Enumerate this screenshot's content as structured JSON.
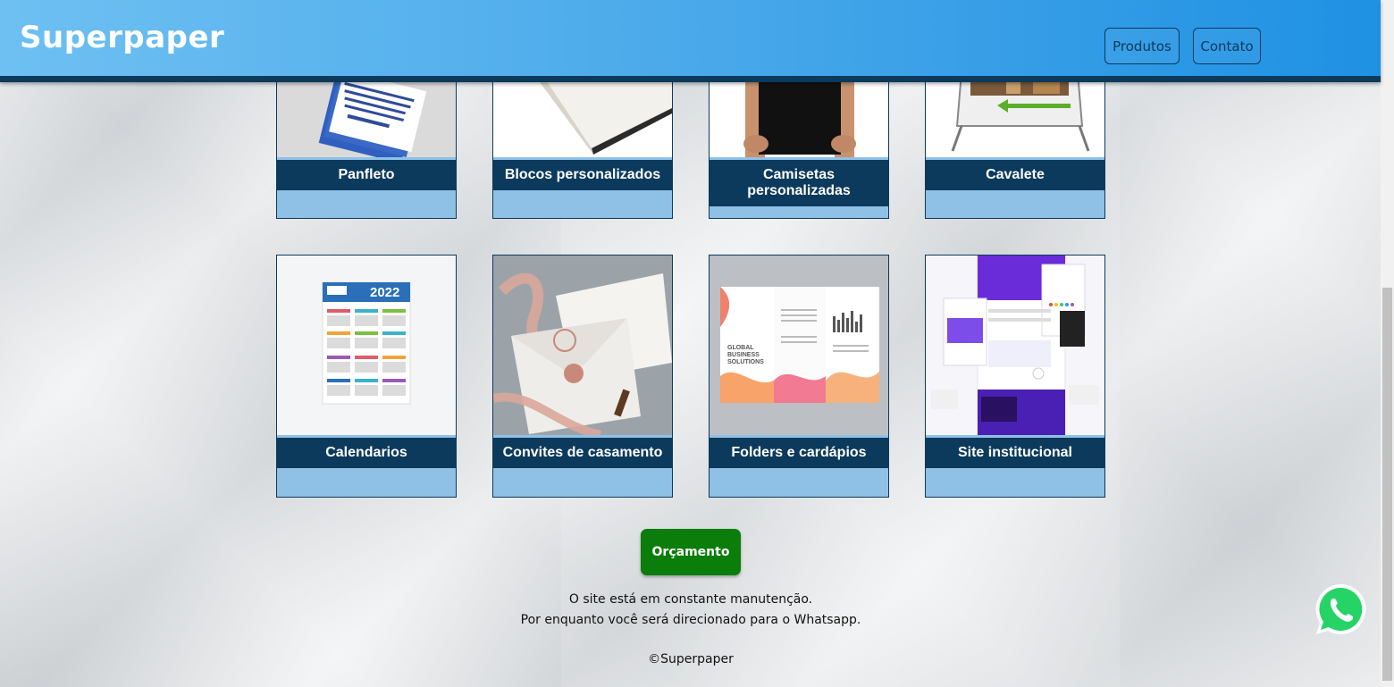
{
  "header": {
    "brand": "Superpaper",
    "nav": [
      "Produtos",
      "Contato"
    ]
  },
  "products": [
    {
      "label": "Panfleto"
    },
    {
      "label": "Blocos personalizados"
    },
    {
      "label": "Camisetas personalizadas"
    },
    {
      "label": "Cavalete"
    },
    {
      "label": "Calendarios",
      "image_text": "2022"
    },
    {
      "label": "Convites de casamento"
    },
    {
      "label": "Folders e cardápios",
      "image_text": "GLOBAL BUSINESS SOLUTIONS"
    },
    {
      "label": "Site institucional"
    }
  ],
  "cta": {
    "label": "Orçamento"
  },
  "footer": {
    "line1": "O site está em constante manutenção.",
    "line2": "Por enquanto você será direcionado para o Whatsapp.",
    "copyright": "©Superpaper"
  },
  "whatsapp": {
    "icon": "whatsapp-icon"
  },
  "colors": {
    "header_start": "#6ec0f2",
    "header_end": "#1f91e3",
    "card_label": "#0c3a5c",
    "card_bg": "#8fc0e6",
    "cta": "#0a7d0a",
    "whatsapp": "#25d366"
  }
}
